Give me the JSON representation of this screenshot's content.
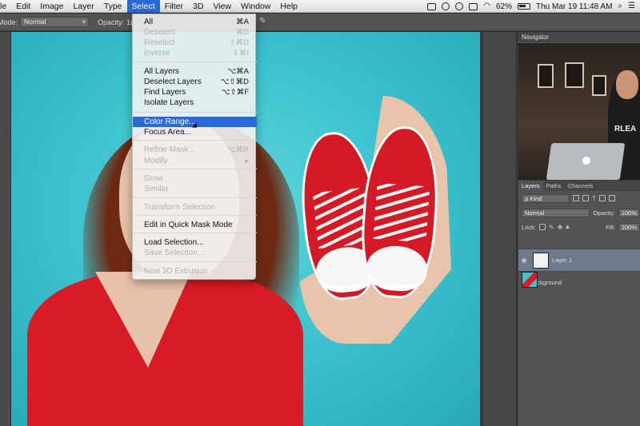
{
  "menubar": {
    "items": [
      "le",
      "Edit",
      "Image",
      "Layer",
      "Type",
      "Select",
      "Filter",
      "3D",
      "View",
      "Window",
      "Help"
    ],
    "active": "Select",
    "battery": "62%",
    "clock": "Thu Mar 19  11:48 AM"
  },
  "options_bar": {
    "mode_label": "Mode:",
    "mode_value": "Normal",
    "opacity_label": "Opacity:",
    "opacity_value": "1("
  },
  "select_menu": {
    "rows": [
      {
        "label": "All",
        "shortcut": "⌘A",
        "disabled": false
      },
      {
        "label": "Deselect",
        "shortcut": "⌘D",
        "disabled": true
      },
      {
        "label": "Reselect",
        "shortcut": "⇧⌘D",
        "disabled": true
      },
      {
        "label": "Inverse",
        "shortcut": "⇧⌘I",
        "disabled": true
      },
      {
        "label": "All Layers",
        "shortcut": "⌥⌘A",
        "disabled": false
      },
      {
        "label": "Deselect Layers",
        "shortcut": "⌥⇧⌘D",
        "disabled": false
      },
      {
        "label": "Find Layers",
        "shortcut": "⌥⇧⌘F",
        "disabled": false
      },
      {
        "label": "Isolate Layers",
        "shortcut": "",
        "disabled": false
      },
      {
        "label": "Color Range...",
        "shortcut": "",
        "disabled": false,
        "highlighted": true
      },
      {
        "label": "Focus Area...",
        "shortcut": "",
        "disabled": false
      },
      {
        "label": "Refine Mask...",
        "shortcut": "⌥⌘R",
        "disabled": true
      },
      {
        "label": "Modify",
        "shortcut": "▸",
        "disabled": true
      },
      {
        "label": "Grow",
        "shortcut": "",
        "disabled": true
      },
      {
        "label": "Similar",
        "shortcut": "",
        "disabled": true
      },
      {
        "label": "Transform Selection",
        "shortcut": "",
        "disabled": true
      },
      {
        "label": "Edit in Quick Mask Mode",
        "shortcut": "",
        "disabled": false
      },
      {
        "label": "Load Selection...",
        "shortcut": "",
        "disabled": false
      },
      {
        "label": "Save Selection...",
        "shortcut": "",
        "disabled": true
      },
      {
        "label": "New 3D Extrusion",
        "shortcut": "",
        "disabled": true
      }
    ]
  },
  "navigator": {
    "title": "Navigator",
    "shirt_text": "RLEA"
  },
  "layers_panel": {
    "tabs": [
      "Layers",
      "Paths",
      "Channels"
    ],
    "kind_label": "ρ Kind",
    "blend_mode": "Normal",
    "opacity_label": "Opacity:",
    "opacity_value": "100%",
    "lock_label": "Lock:",
    "fill_label": "Fill:",
    "fill_value": "100%",
    "layers": [
      {
        "name": "Layer 1",
        "selected": true
      },
      {
        "name": "Background",
        "selected": false
      }
    ]
  }
}
